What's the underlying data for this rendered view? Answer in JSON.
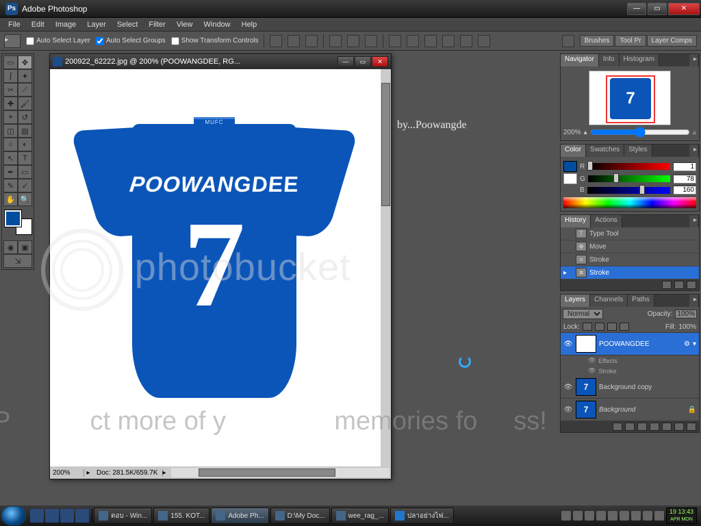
{
  "app": {
    "title": "Adobe Photoshop"
  },
  "menu": [
    "File",
    "Edit",
    "Image",
    "Layer",
    "Select",
    "Filter",
    "View",
    "Window",
    "Help"
  ],
  "options": {
    "auto_select_layer": "Auto Select Layer",
    "auto_select_groups": "Auto Select Groups",
    "show_transform": "Show Transform Controls",
    "tabs": [
      "Brushes",
      "Tool Pr",
      "Layer Comps"
    ]
  },
  "doc": {
    "title": "200922_62222.jpg @ 200% (POOWANGDEE, RG...",
    "zoom": "200%",
    "info": "Doc: 281.5K/659.7K",
    "jersey": {
      "collar": "MUFC",
      "name": "POOWANGDEE",
      "number": "7"
    }
  },
  "watermark": {
    "brand": "photobucket",
    "tagline_left": "P",
    "tagline_mid": "ct more of y",
    "tagline_right": "memories fo"
  },
  "byline": "by...Poowangde",
  "navigator": {
    "tabs": [
      "Navigator",
      "Info",
      "Histogram"
    ],
    "zoom": "200%"
  },
  "color": {
    "tabs": [
      "Color",
      "Swatches",
      "Styles"
    ],
    "r": {
      "label": "R",
      "value": "1",
      "pct": 0
    },
    "g": {
      "label": "G",
      "value": "78",
      "pct": 31
    },
    "b": {
      "label": "B",
      "value": "160",
      "pct": 63
    },
    "swatch": "#014ea0"
  },
  "history": {
    "tabs": [
      "History",
      "Actions"
    ],
    "items": [
      {
        "icon": "T",
        "label": "Type Tool"
      },
      {
        "icon": "⇱",
        "label": "Move"
      },
      {
        "icon": "≡",
        "label": "Stroke"
      },
      {
        "icon": "≡",
        "label": "Stroke",
        "selected": true
      }
    ]
  },
  "layers": {
    "tabs": [
      "Layers",
      "Channels",
      "Paths"
    ],
    "blend": "Normal",
    "opacity_label": "Opacity:",
    "opacity": "100%",
    "lock_label": "Lock:",
    "fill_label": "Fill:",
    "fill": "100%",
    "items": [
      {
        "name": "POOWANGDEE",
        "type": "text",
        "selected": true,
        "effects": [
          "Effects",
          "Stroke"
        ]
      },
      {
        "name": "Background copy",
        "type": "jersey"
      },
      {
        "name": "Background",
        "type": "jersey",
        "locked": true,
        "italic": true
      }
    ]
  },
  "taskbar": {
    "items": [
      "ตอบ - Win...",
      "155. KOT...",
      "Adobe Ph...",
      "D:\\My Doc...",
      "wee_rag_...",
      "ปลาอย่างไฟ..."
    ],
    "clock": {
      "date": "19",
      "month": "APR",
      "time": "13:43",
      "day": "MON"
    }
  }
}
